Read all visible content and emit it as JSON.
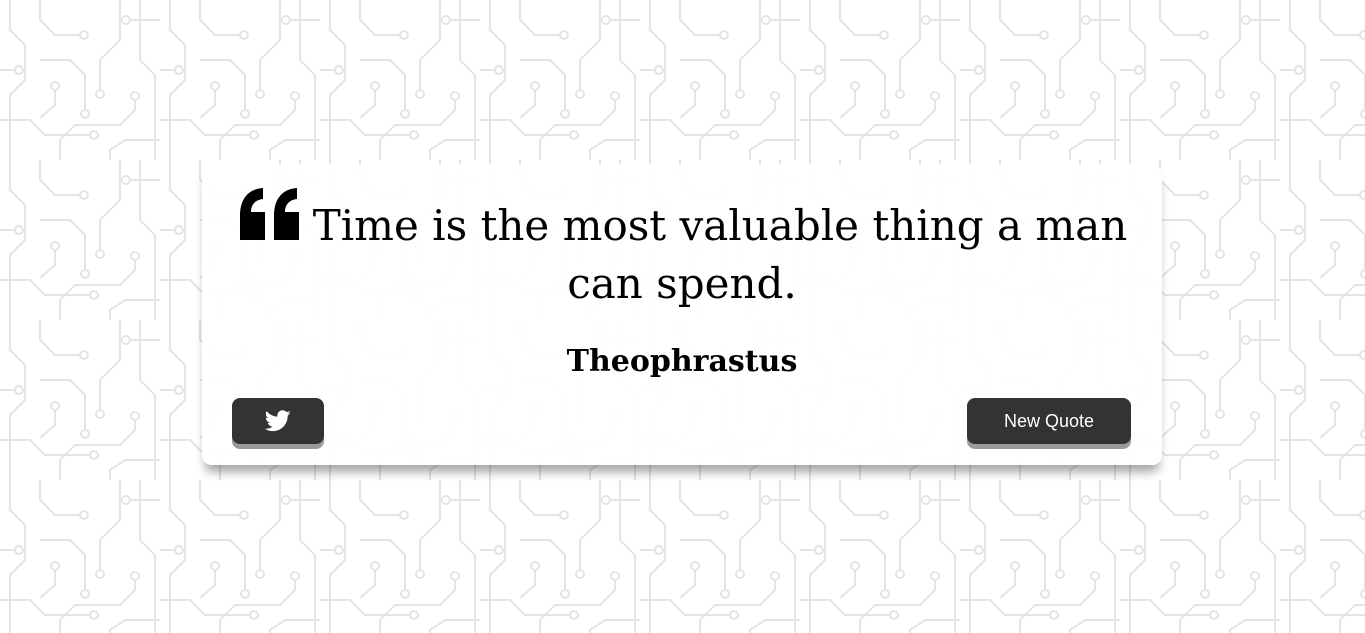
{
  "background": {
    "pattern": "circuit-board",
    "line_color": "#e6e6e6",
    "base_color": "#ffffff"
  },
  "quote": {
    "text": "Time is the most valuable thing a man can spend.",
    "author": "Theophrastus",
    "icon": "quote-left-icon"
  },
  "buttons": {
    "tweet_icon": "twitter-icon",
    "new_quote_label": "New Quote"
  },
  "colors": {
    "button_bg": "#333333",
    "button_shadow": "#9a9a9a",
    "text": "#000000"
  }
}
